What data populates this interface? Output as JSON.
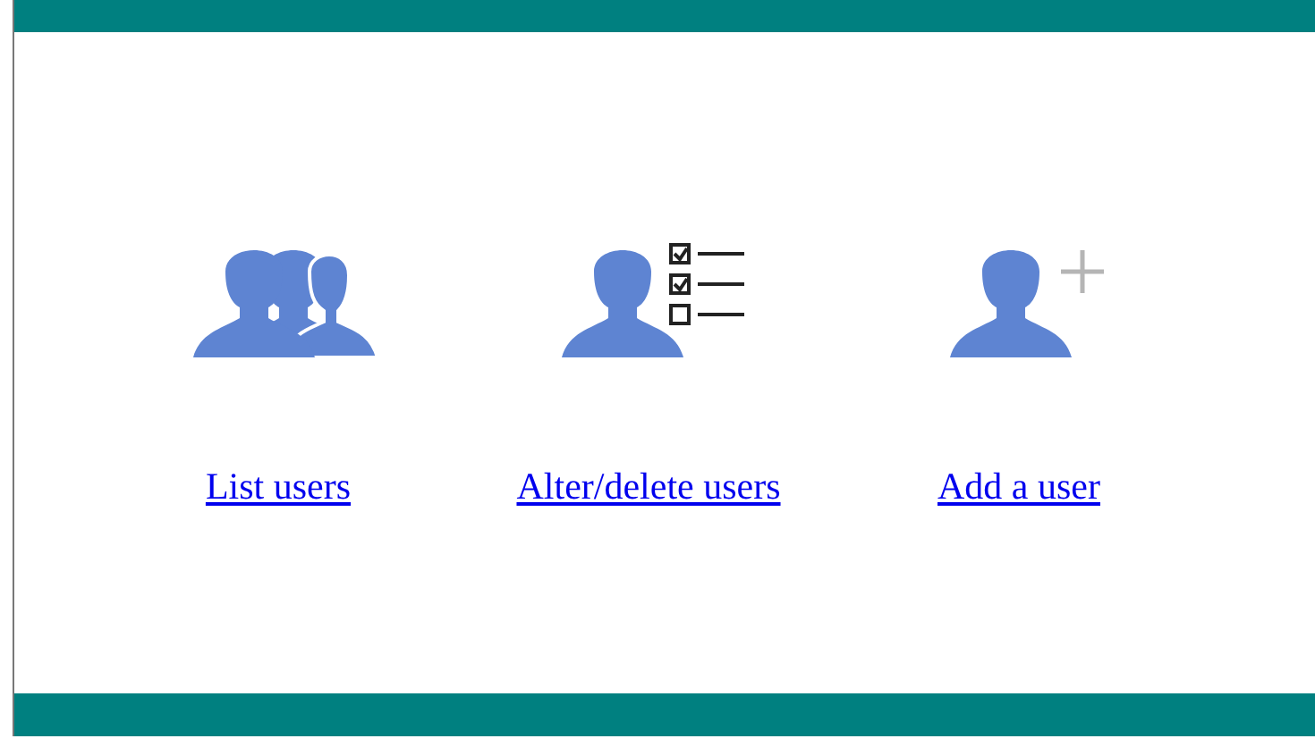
{
  "actions": [
    {
      "kind": "group",
      "label": "List users"
    },
    {
      "kind": "manage",
      "label": "Alter/delete users"
    },
    {
      "kind": "add",
      "label": "Add a user"
    }
  ]
}
